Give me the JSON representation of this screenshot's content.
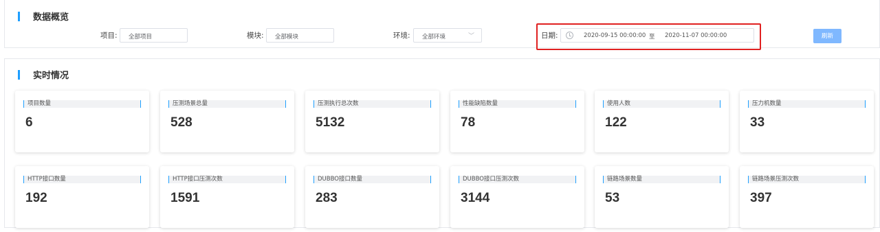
{
  "overview": {
    "title": "数据概览",
    "project_label": "项目:",
    "project_value": "全部项目",
    "module_label": "模块:",
    "module_value": "全部模块",
    "env_label": "环境:",
    "env_value": "全部环境",
    "date_label": "日期:",
    "date_start": "2020-09-15 00:00:00",
    "date_separator": "至",
    "date_end": "2020-11-07 00:00:00",
    "refresh_label": "刷新"
  },
  "realtime": {
    "title": "实时情况",
    "cards": [
      {
        "label": "项目数量",
        "value": "6"
      },
      {
        "label": "压测场景总量",
        "value": "528"
      },
      {
        "label": "压测执行总次数",
        "value": "5132"
      },
      {
        "label": "性能缺陷数量",
        "value": "78"
      },
      {
        "label": "使用人数",
        "value": "122"
      },
      {
        "label": "压力机数量",
        "value": "33"
      },
      {
        "label": "HTTP接口数量",
        "value": "192"
      },
      {
        "label": "HTTP接口压测次数",
        "value": "1591"
      },
      {
        "label": "DUBBO接口数量",
        "value": "283"
      },
      {
        "label": "DUBBO接口压测次数",
        "value": "3144"
      },
      {
        "label": "链路场景数量",
        "value": "53"
      },
      {
        "label": "链路场景压测次数",
        "value": "397"
      }
    ]
  },
  "colors": {
    "accent": "#1e9fff",
    "highlight_border": "#e02020",
    "refresh_button": "#7fb8ff"
  }
}
